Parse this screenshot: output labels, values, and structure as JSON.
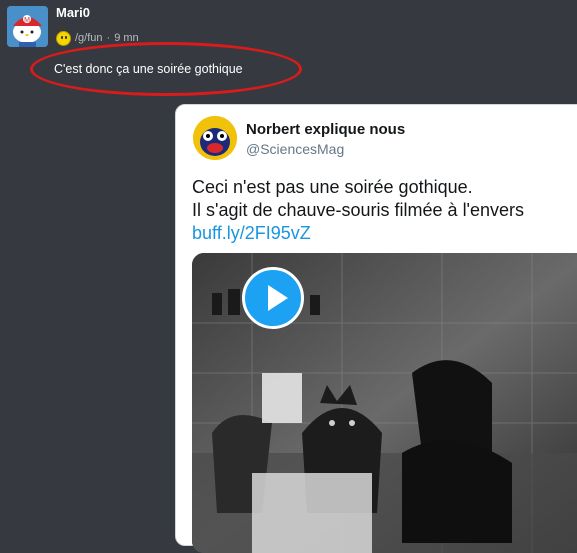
{
  "post": {
    "username": "Mari0",
    "forum": "/g/fun",
    "separator": "·",
    "time": "9 mn",
    "message": "C'est donc ça une soirée gothique"
  },
  "tweet": {
    "name": "Norbert explique nous",
    "handle": "@SciencesMag",
    "line1": "Ceci n'est pas une soirée gothique.",
    "line2": "Il s'agit de chauve-souris filmée à l'envers",
    "link": "buff.ly/2FI95vZ"
  },
  "colors": {
    "background": "#36393f",
    "highlight_circle": "#d81c1c",
    "link": "#1b95e0",
    "play_button": "#1da1f2"
  },
  "icons": [
    "hello-kitty-avatar",
    "smiley-icon",
    "play-icon"
  ]
}
